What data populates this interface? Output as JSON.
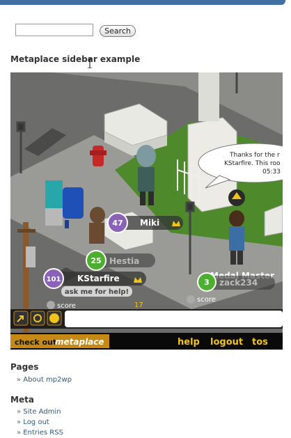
{
  "search": {
    "value": "",
    "button_label": "Search"
  },
  "widget_title": "Metaplace sidebar example",
  "game": {
    "chat_bubble": [
      "Thanks for the r",
      "KStarfire. This roo",
      "05:33"
    ],
    "players": [
      {
        "name": "Miki",
        "level": "47"
      },
      {
        "name": "Hestia",
        "level": "25"
      },
      {
        "name": "KStarfire",
        "level": "101"
      },
      {
        "name": "zack234",
        "level": "3"
      },
      {
        "name": "Medal Master",
        "level": ""
      }
    ],
    "ask_bubble": "ask me for help!",
    "score_labels": [
      "score",
      "score"
    ],
    "floor_number": "17",
    "bottom_bar": {
      "brand_prefix": "check out",
      "brand_name": "metaplace",
      "links": [
        "help",
        "logout",
        "tos"
      ]
    },
    "icons": [
      "external-link-icon",
      "gear-icon",
      "chat-icon"
    ]
  },
  "sections": [
    {
      "title": "Pages",
      "items": [
        "About mp2wp"
      ]
    },
    {
      "title": "Meta",
      "items": [
        "Site Admin",
        "Log out",
        "Entries RSS"
      ]
    }
  ]
}
